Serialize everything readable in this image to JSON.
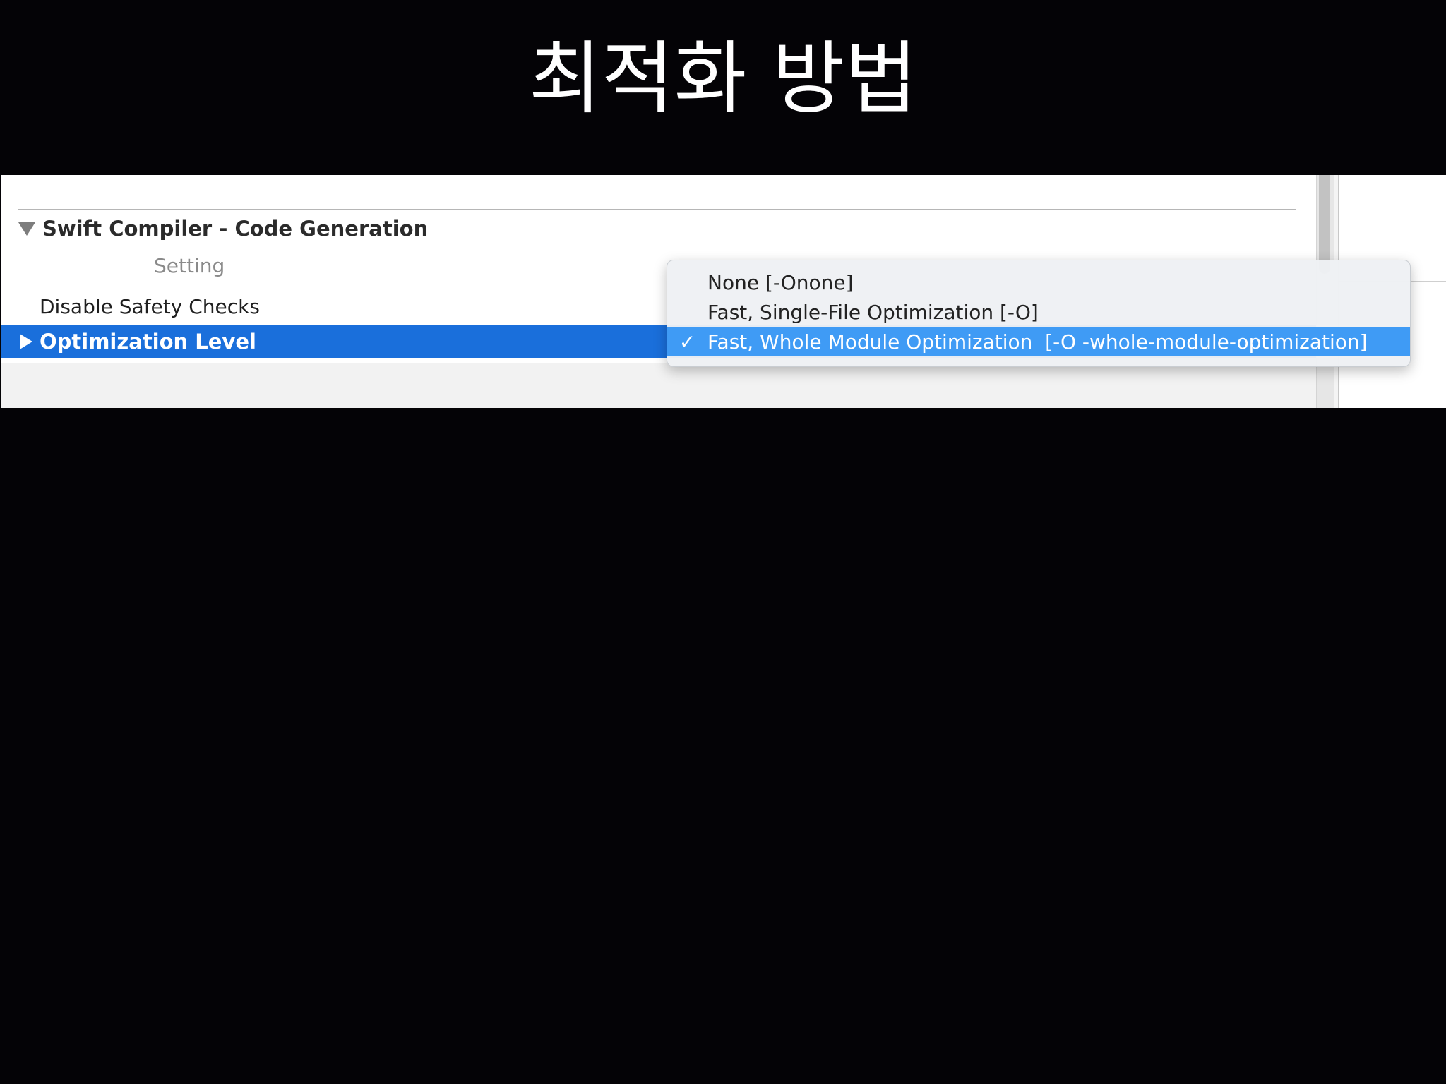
{
  "slide": {
    "title": "최적화 방법"
  },
  "build_settings": {
    "section_title": "Swift Compiler - Code Generation",
    "column_header": "Setting",
    "rows": [
      {
        "label": "Disable Safety Checks"
      },
      {
        "label": "Optimization Level",
        "selected": true
      }
    ]
  },
  "popup_menu": {
    "options": [
      {
        "label": "None [-Onone]",
        "checked": false
      },
      {
        "label": "Fast, Single-File Optimization [-O]",
        "checked": false
      },
      {
        "label": "Fast, Whole Module Optimization  [-O -whole-module-optimization]",
        "checked": true
      }
    ],
    "check_glyph": "✓"
  },
  "colors": {
    "selection_blue": "#1a6fdb",
    "menu_highlight": "#3f9bf5"
  }
}
